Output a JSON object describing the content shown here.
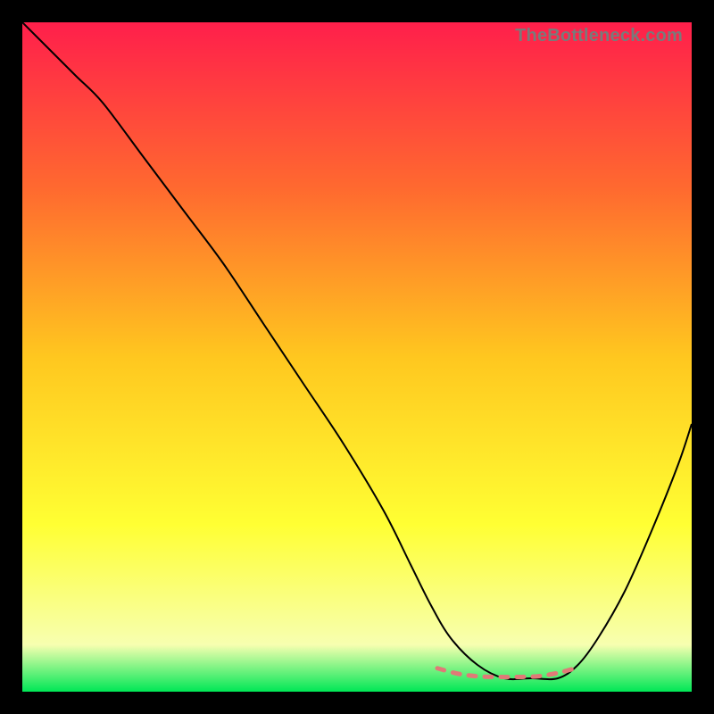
{
  "watermark": "TheBottleneck.com",
  "chart_data": {
    "type": "line",
    "title": "",
    "xlabel": "",
    "ylabel": "",
    "xlim": [
      0,
      100
    ],
    "ylim": [
      0,
      100
    ],
    "gradient_stops": [
      {
        "offset": 0,
        "color": "#ff1f4b"
      },
      {
        "offset": 25,
        "color": "#ff6a2f"
      },
      {
        "offset": 50,
        "color": "#ffc71f"
      },
      {
        "offset": 75,
        "color": "#ffff33"
      },
      {
        "offset": 93,
        "color": "#f7ffb0"
      },
      {
        "offset": 100,
        "color": "#00e756"
      }
    ],
    "series": [
      {
        "name": "bottleneck-curve",
        "color": "#000000",
        "width": 2,
        "x": [
          0,
          4,
          8,
          12,
          18,
          24,
          30,
          36,
          42,
          48,
          54,
          58,
          61,
          64,
          68,
          72,
          76,
          80,
          83,
          86,
          90,
          94,
          98,
          100
        ],
        "y": [
          100,
          96,
          92,
          88,
          80,
          72,
          64,
          55,
          46,
          37,
          27,
          19,
          13,
          8,
          4,
          2,
          2,
          2,
          4,
          8,
          15,
          24,
          34,
          40
        ]
      }
    ],
    "flat_band": {
      "color": "#e07a77",
      "width": 5,
      "x": [
        62,
        65,
        68,
        71,
        74,
        77,
        80,
        83
      ],
      "y": [
        3.5,
        2.7,
        2.3,
        2.2,
        2.2,
        2.3,
        2.8,
        3.6
      ]
    }
  }
}
